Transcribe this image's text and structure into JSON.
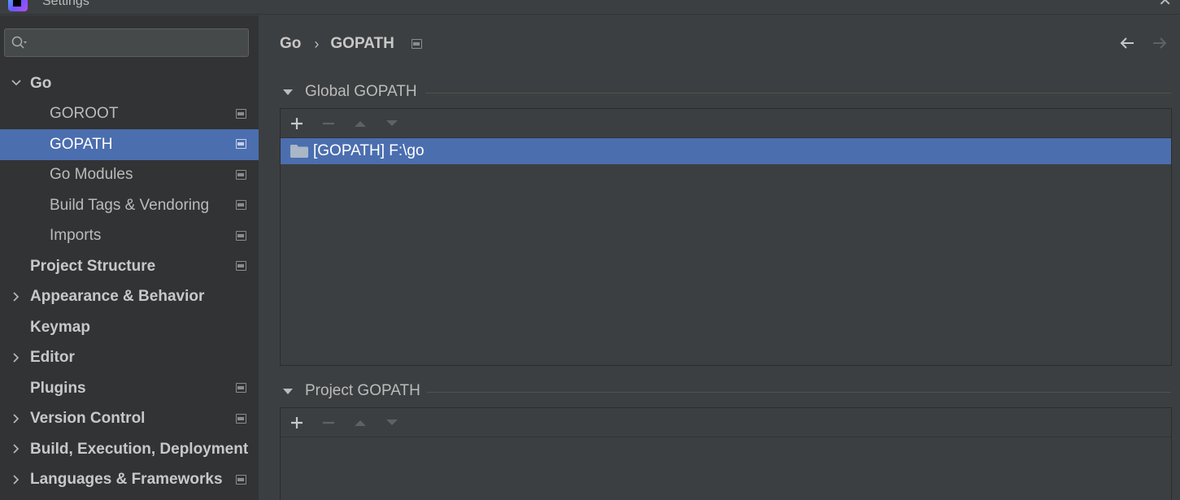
{
  "window": {
    "title": "Settings",
    "close_icon": "close-icon"
  },
  "search": {
    "placeholder": "",
    "value": ""
  },
  "sidebar": {
    "items": [
      {
        "label": "Go",
        "bold": true,
        "expanded": true
      },
      {
        "label": "GOROOT"
      },
      {
        "label": "GOPATH",
        "selected": true
      },
      {
        "label": "Go Modules"
      },
      {
        "label": "Build Tags & Vendoring"
      },
      {
        "label": "Imports"
      },
      {
        "label": "Project Structure"
      },
      {
        "label": "Appearance & Behavior"
      },
      {
        "label": "Keymap"
      },
      {
        "label": "Editor"
      },
      {
        "label": "Plugins"
      },
      {
        "label": "Version Control"
      },
      {
        "label": "Build, Execution, Deployment"
      },
      {
        "label": "Languages & Frameworks"
      }
    ]
  },
  "breadcrumb": {
    "parent": "Go",
    "separator": "›",
    "current": "GOPATH"
  },
  "global_gopath": {
    "title": "Global GOPATH",
    "entries": [
      {
        "label": "[GOPATH] F:\\go",
        "selected": true
      }
    ]
  },
  "project_gopath": {
    "title": "Project GOPATH",
    "entries": []
  },
  "colors": {
    "selection": "#4b6eaf",
    "sidebar_bg": "#313335",
    "panel_bg": "#3c3f41"
  }
}
